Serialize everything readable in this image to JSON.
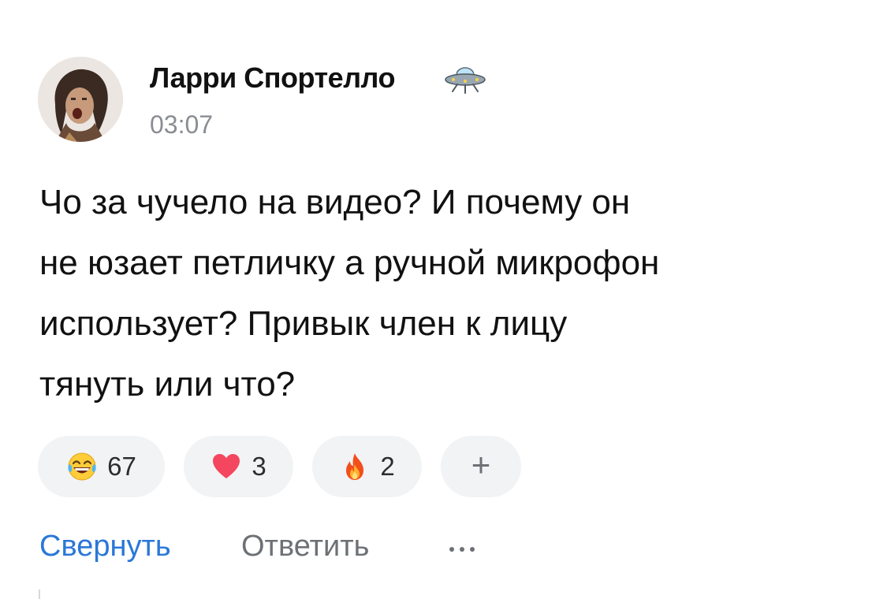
{
  "comment": {
    "author": {
      "name": "Ларри Спортелло",
      "badge_icon": "ufo-icon",
      "avatar_icon": "avatar-photo"
    },
    "timestamp": "03:07",
    "text_lines": [
      "Чо за чучело на видео? И почему он",
      "не юзает петличку а ручной микрофон",
      "использует? Привык член к лицу",
      "тянуть или что?"
    ],
    "reactions": [
      {
        "icon": "laughing-emoji-icon",
        "count": "67"
      },
      {
        "icon": "heart-icon",
        "count": "3"
      },
      {
        "icon": "fire-icon",
        "count": "2"
      }
    ],
    "add_reaction_label": "+",
    "actions": {
      "collapse_label": "Свернуть",
      "reply_label": "Ответить",
      "more_icon": "more-dots-icon"
    }
  },
  "colors": {
    "link": "#2a77d8",
    "muted": "#6d7175",
    "timestamp": "#8a8d92",
    "pill_bg": "#f2f3f5",
    "text": "#111111"
  }
}
